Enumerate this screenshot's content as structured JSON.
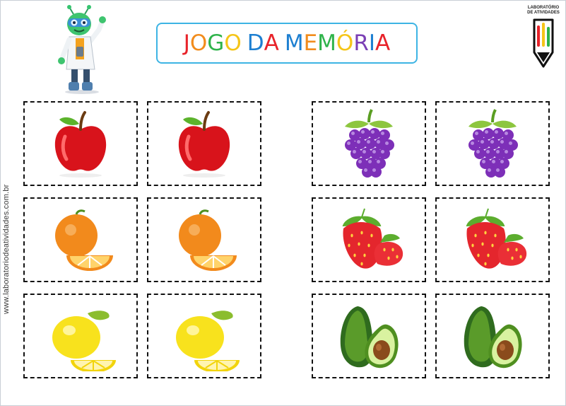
{
  "page": {
    "title_letters": [
      {
        "ch": "J",
        "color": "#e8232a"
      },
      {
        "ch": "O",
        "color": "#f28c1c"
      },
      {
        "ch": "G",
        "color": "#2eb34a"
      },
      {
        "ch": "O",
        "color": "#f5c518"
      },
      {
        "ch": " ",
        "color": "#000000"
      },
      {
        "ch": "D",
        "color": "#1d7fd1"
      },
      {
        "ch": "A",
        "color": "#e8232a"
      },
      {
        "ch": " ",
        "color": "#000000"
      },
      {
        "ch": "M",
        "color": "#1d7fd1"
      },
      {
        "ch": "E",
        "color": "#f28c1c"
      },
      {
        "ch": "M",
        "color": "#2eb34a"
      },
      {
        "ch": "Ó",
        "color": "#f5c518"
      },
      {
        "ch": "R",
        "color": "#7b3fb5"
      },
      {
        "ch": "I",
        "color": "#1d7fd1"
      },
      {
        "ch": "A",
        "color": "#e8232a"
      }
    ],
    "side_url": "www.laboratoriodeatividades.com.br",
    "logo_line1": "LABORATÓRIO",
    "logo_line2": "DE ATIVIDADES"
  },
  "cards": [
    {
      "fruit": "apple"
    },
    {
      "fruit": "apple"
    },
    {
      "fruit": "grapes"
    },
    {
      "fruit": "grapes"
    },
    {
      "fruit": "orange"
    },
    {
      "fruit": "orange"
    },
    {
      "fruit": "strawberry"
    },
    {
      "fruit": "strawberry"
    },
    {
      "fruit": "lemon"
    },
    {
      "fruit": "lemon"
    },
    {
      "fruit": "avocado"
    },
    {
      "fruit": "avocado"
    }
  ],
  "colors": {
    "title_border": "#3db4e4",
    "card_border": "#111111"
  }
}
